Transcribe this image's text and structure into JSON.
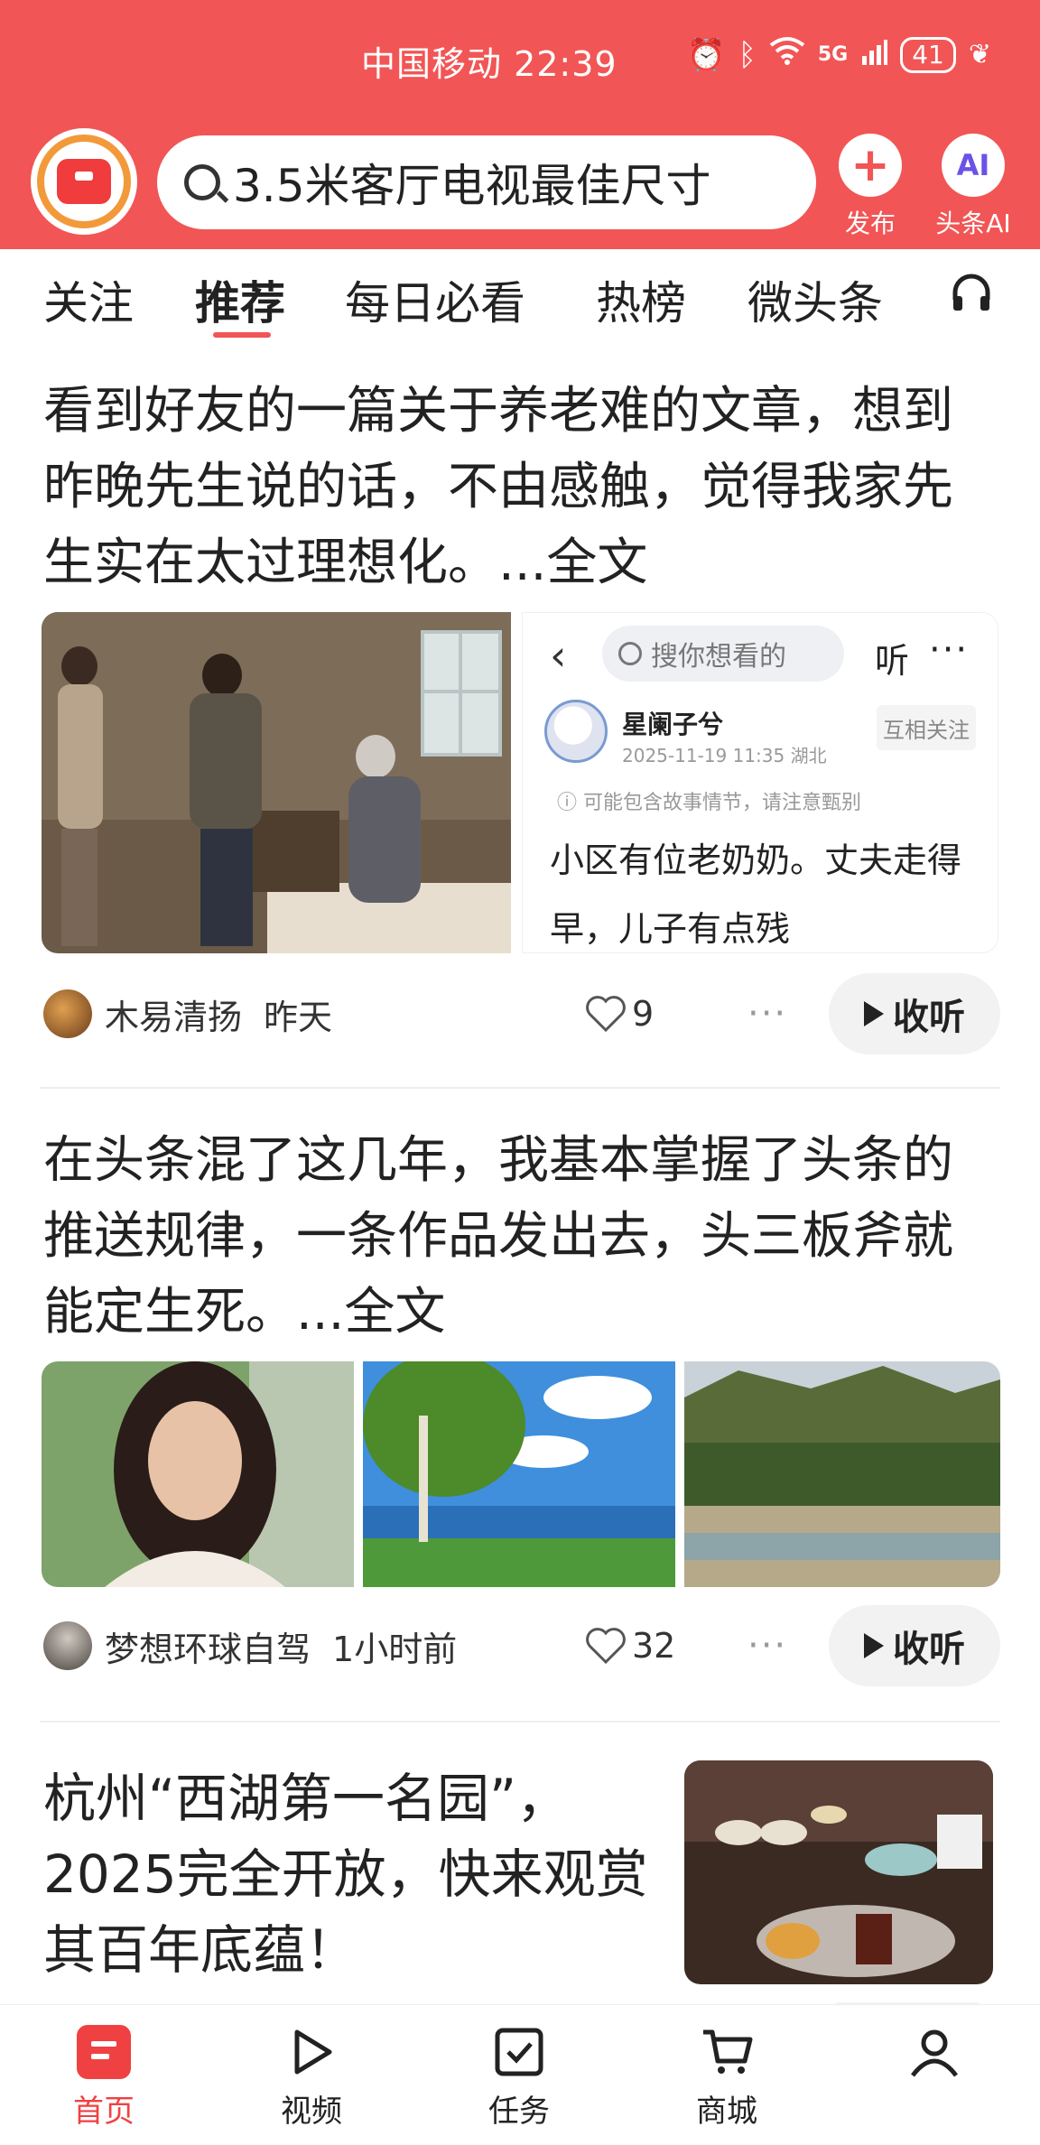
{
  "status_bar": {
    "carrier_time": "中国移动 22:39",
    "signal": "5G",
    "battery": "41"
  },
  "header": {
    "search_query": "3.5米客厅电视最佳尺寸",
    "publish_label": "发布",
    "ai_icon_text": "AI",
    "ai_label": "头条AI"
  },
  "tabs": [
    "关注",
    "推荐",
    "每日必看",
    "热榜",
    "微头条"
  ],
  "active_tab": "推荐",
  "articles": [
    {
      "title": "看到好友的一篇关于养老难的文章，想到昨晚先生说的话，不由感触，觉得我家先生实在太过理想化。...全文",
      "author": "木易清扬",
      "time": "昨天",
      "likes": "9",
      "listen_label": "收听",
      "embedded_post": {
        "search_placeholder": "搜你想看的",
        "listen": "听",
        "author": "星阑子兮",
        "date_location": "2025-11-19 11:35 湖北",
        "follow_label": "互相关注",
        "warning": "ⓘ 可能包含故事情节，请注意甄别",
        "body": "小区有位老奶奶。丈夫走得早，儿子有点残"
      }
    },
    {
      "title": "在头条混了这几年，我基本掌握了头条的推送规律，一条作品发出去，头三板斧就能定生死。...全文",
      "author": "梦想环球自驾",
      "time": "1小时前",
      "likes": "32",
      "listen_label": "收听"
    },
    {
      "title": "杭州“西湖第一名园”，2025完全开放，快来观赏其百年底蕴！"
    }
  ],
  "bottom_nav": [
    {
      "label": "首页",
      "icon": "home-icon",
      "active": true
    },
    {
      "label": "视频",
      "icon": "video-play-icon",
      "active": false
    },
    {
      "label": "任务",
      "icon": "task-check-icon",
      "active": false
    },
    {
      "label": "商城",
      "icon": "cart-icon",
      "active": false
    },
    {
      "label": "",
      "icon": "profile-icon",
      "active": false
    }
  ],
  "colors": {
    "brand_red": "#f25555",
    "active_nav_red": "#f04142"
  }
}
